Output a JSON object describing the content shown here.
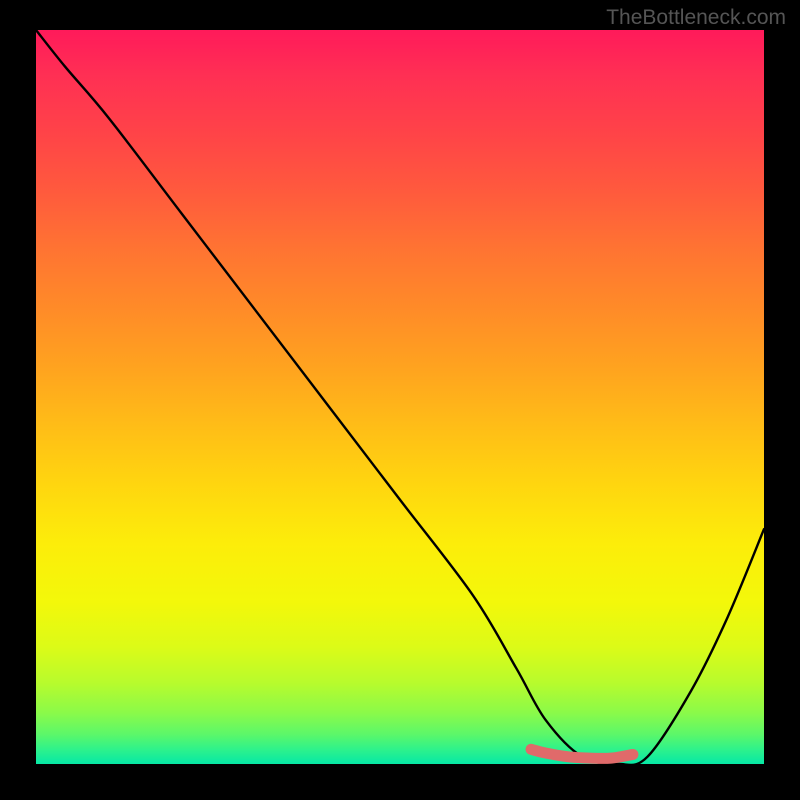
{
  "watermark": "TheBottleneck.com",
  "chart_data": {
    "type": "line",
    "title": "",
    "xlabel": "",
    "ylabel": "",
    "xlim": [
      0,
      100
    ],
    "ylim": [
      0,
      100
    ],
    "grid": false,
    "series": [
      {
        "name": "curve",
        "color": "#000000",
        "x": [
          0,
          4,
          10,
          20,
          30,
          40,
          50,
          60,
          66,
          70,
          75,
          80,
          84,
          90,
          95,
          100
        ],
        "values": [
          100,
          95,
          88,
          75,
          62,
          49,
          36,
          23,
          13,
          6,
          1,
          0,
          1,
          10,
          20,
          32
        ]
      },
      {
        "name": "highlight-flat",
        "color": "#e06a6a",
        "x": [
          68,
          70,
          73,
          76,
          79,
          82
        ],
        "values": [
          2,
          1.5,
          1,
          0.8,
          0.8,
          1.3
        ]
      }
    ],
    "annotations": []
  }
}
